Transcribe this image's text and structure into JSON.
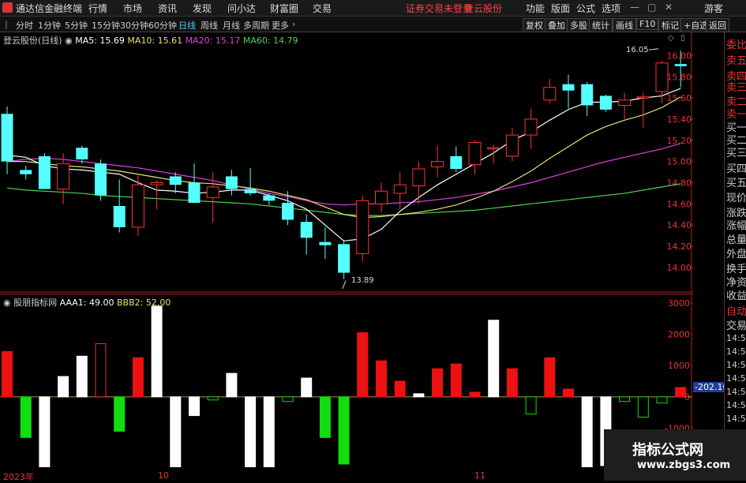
{
  "menubar": {
    "app_title": "通达信金融终端",
    "items": [
      "行情",
      "市场",
      "资讯",
      "发现",
      "问小达",
      "财富圈",
      "交易"
    ],
    "notice": "证券交易未登录",
    "stock": "登云股份",
    "right_items": [
      "功能",
      "版面",
      "公式",
      "选项"
    ],
    "user": "游客"
  },
  "toolbar": {
    "periods": [
      "分时",
      "1分钟",
      "5分钟",
      "15分钟",
      "30分钟",
      "60分钟",
      "日线",
      "周线",
      "月线",
      "多周期",
      "更多"
    ],
    "active_period": "日线",
    "right_buttons": [
      "复权",
      "叠加",
      "多股",
      "统计",
      "画线",
      "F10",
      "标记",
      "+自选",
      "返回"
    ]
  },
  "chart_header": {
    "stock_label": "登云股份(日线)",
    "ma5": "MA5: 15.69",
    "ma10": "MA10: 15.61",
    "ma20": "MA20: 15.17",
    "ma60": "MA60: 14.79"
  },
  "sub_header": {
    "name": "股朋指标网",
    "aaa1": "AAA1: 49.00",
    "bbb2": "BBB2: 52.00"
  },
  "annotations": {
    "high": "16.05",
    "low": "13.89",
    "current_sub": "-202.10"
  },
  "x_labels": [
    "2023年",
    "10",
    "11"
  ],
  "right_panel": {
    "red_items": [
      "委比",
      "卖五",
      "卖四",
      "卖三",
      "卖二",
      "卖一"
    ],
    "white_items": [
      "买一",
      "买二",
      "买三",
      "买四",
      "买五",
      "现价",
      "涨跌",
      "涨幅",
      "总量",
      "外盘",
      "换手",
      "净资",
      "收益"
    ],
    "bottom_items": [
      "自动",
      "交易"
    ],
    "times": [
      "14:55",
      "14:56",
      "14:56",
      "14:56",
      "14:56",
      "14:56",
      "14:56"
    ]
  },
  "watermark": {
    "title": "指标公式网",
    "url": "www.zbgs3.com"
  },
  "colors": {
    "up": "#ff3333",
    "down": "#54ffff",
    "ma5": "#ffffff",
    "ma10": "#e8e070",
    "ma20": "#e040e0",
    "ma60": "#50d050"
  },
  "chart_data": [
    {
      "type": "candlestick",
      "y_ticks": [
        16.0,
        15.8,
        15.6,
        15.4,
        15.2,
        15.0,
        14.8,
        14.6,
        14.4,
        14.2,
        14.0
      ],
      "ylim": [
        13.85,
        16.1
      ],
      "candles": [
        {
          "o": 15.45,
          "h": 15.52,
          "l": 14.88,
          "c": 15.0
        },
        {
          "o": 14.92,
          "h": 14.96,
          "l": 14.83,
          "c": 14.88
        },
        {
          "o": 15.05,
          "h": 15.08,
          "l": 14.78,
          "c": 14.74
        },
        {
          "o": 14.74,
          "h": 15.08,
          "l": 14.6,
          "c": 14.98
        },
        {
          "o": 15.13,
          "h": 15.15,
          "l": 14.98,
          "c": 15.02
        },
        {
          "o": 14.98,
          "h": 15.02,
          "l": 14.63,
          "c": 14.68
        },
        {
          "o": 14.58,
          "h": 14.83,
          "l": 14.33,
          "c": 14.38
        },
        {
          "o": 14.38,
          "h": 14.87,
          "l": 14.3,
          "c": 14.78
        },
        {
          "o": 14.78,
          "h": 14.82,
          "l": 14.55,
          "c": 14.8
        },
        {
          "o": 14.86,
          "h": 14.9,
          "l": 14.7,
          "c": 14.78
        },
        {
          "o": 14.8,
          "h": 14.98,
          "l": 14.62,
          "c": 14.61
        },
        {
          "o": 14.66,
          "h": 14.9,
          "l": 14.42,
          "c": 14.76
        },
        {
          "o": 14.86,
          "h": 14.92,
          "l": 14.68,
          "c": 14.74
        },
        {
          "o": 14.74,
          "h": 14.94,
          "l": 14.68,
          "c": 14.7
        },
        {
          "o": 14.68,
          "h": 14.7,
          "l": 14.59,
          "c": 14.63
        },
        {
          "o": 14.61,
          "h": 14.72,
          "l": 14.4,
          "c": 14.45
        },
        {
          "o": 14.43,
          "h": 14.5,
          "l": 14.12,
          "c": 14.28
        },
        {
          "o": 14.24,
          "h": 14.38,
          "l": 14.08,
          "c": 14.21
        },
        {
          "o": 14.22,
          "h": 14.26,
          "l": 13.89,
          "c": 13.95
        },
        {
          "o": 14.13,
          "h": 14.68,
          "l": 14.06,
          "c": 14.63
        },
        {
          "o": 14.6,
          "h": 14.8,
          "l": 14.52,
          "c": 14.72
        },
        {
          "o": 14.7,
          "h": 14.9,
          "l": 14.55,
          "c": 14.78
        },
        {
          "o": 14.77,
          "h": 15.0,
          "l": 14.6,
          "c": 14.93
        },
        {
          "o": 14.95,
          "h": 15.15,
          "l": 14.85,
          "c": 15.0
        },
        {
          "o": 15.05,
          "h": 15.14,
          "l": 14.9,
          "c": 14.93
        },
        {
          "o": 14.97,
          "h": 15.2,
          "l": 14.88,
          "c": 15.18
        },
        {
          "o": 15.13,
          "h": 15.16,
          "l": 14.98,
          "c": 15.13
        },
        {
          "o": 15.05,
          "h": 15.32,
          "l": 15.0,
          "c": 15.25
        },
        {
          "o": 15.25,
          "h": 15.5,
          "l": 15.12,
          "c": 15.4
        },
        {
          "o": 15.58,
          "h": 15.78,
          "l": 15.55,
          "c": 15.7
        },
        {
          "o": 15.73,
          "h": 15.82,
          "l": 15.5,
          "c": 15.67
        },
        {
          "o": 15.73,
          "h": 15.75,
          "l": 15.43,
          "c": 15.53
        },
        {
          "o": 15.62,
          "h": 15.63,
          "l": 15.47,
          "c": 15.49
        },
        {
          "o": 15.53,
          "h": 15.65,
          "l": 15.4,
          "c": 15.58
        },
        {
          "o": 15.6,
          "h": 15.65,
          "l": 15.32,
          "c": 15.61
        },
        {
          "o": 15.66,
          "h": 15.95,
          "l": 15.55,
          "c": 15.93
        },
        {
          "o": 15.92,
          "h": 16.05,
          "l": 15.7,
          "c": 15.9
        }
      ],
      "ma5": [
        15.06,
        15.04,
        14.96,
        14.93,
        14.92,
        14.9,
        14.88,
        14.8,
        14.73,
        14.72,
        14.7,
        14.71,
        14.73,
        14.73,
        14.68,
        14.63,
        14.55,
        14.4,
        14.25,
        14.27,
        14.36,
        14.53,
        14.66,
        14.78,
        14.88,
        14.98,
        15.08,
        15.2,
        15.28,
        15.39,
        15.49,
        15.56,
        15.56,
        15.57,
        15.6,
        15.62,
        15.69
      ],
      "ma10": [
        15.0,
        15.0,
        14.98,
        14.96,
        14.95,
        14.93,
        14.91,
        14.88,
        14.85,
        14.82,
        14.8,
        14.79,
        14.77,
        14.75,
        14.72,
        14.68,
        14.64,
        14.57,
        14.5,
        14.47,
        14.48,
        14.5,
        14.52,
        14.55,
        14.59,
        14.65,
        14.72,
        14.81,
        14.91,
        15.03,
        15.14,
        15.25,
        15.33,
        15.39,
        15.44,
        15.51,
        15.61
      ],
      "ma20": [
        15.0,
        15.02,
        15.03,
        15.02,
        15.0,
        14.98,
        14.96,
        14.94,
        14.91,
        14.88,
        14.85,
        14.82,
        14.78,
        14.74,
        14.7,
        14.67,
        14.63,
        14.6,
        14.59,
        14.6,
        14.6,
        14.61,
        14.62,
        14.64,
        14.66,
        14.69,
        14.72,
        14.76,
        14.8,
        14.85,
        14.9,
        14.95,
        15.0,
        15.04,
        15.08,
        15.12,
        15.17
      ],
      "ma60": [
        14.75,
        14.73,
        14.72,
        14.71,
        14.7,
        14.68,
        14.67,
        14.66,
        14.65,
        14.64,
        14.63,
        14.62,
        14.61,
        14.6,
        14.58,
        14.56,
        14.54,
        14.52,
        14.5,
        14.49,
        14.49,
        14.5,
        14.51,
        14.52,
        14.53,
        14.54,
        14.56,
        14.58,
        14.6,
        14.62,
        14.64,
        14.66,
        14.68,
        14.7,
        14.73,
        14.76,
        14.79
      ]
    },
    {
      "type": "bar",
      "title": "股朋指标网",
      "y_ticks": [
        3000,
        2000,
        1000,
        0,
        -1000
      ],
      "ylim": [
        -2200,
        3200
      ],
      "values": [
        1450,
        -1300,
        -2550,
        650,
        1300,
        1700,
        -1100,
        1250,
        2900,
        -2450,
        -600,
        -100,
        750,
        -2450,
        -2450,
        -150,
        600,
        -1300,
        -2150,
        2050,
        1150,
        500,
        100,
        900,
        1050,
        150,
        2450,
        900,
        -550,
        1250,
        250,
        -2900,
        -2200,
        -150,
        -650,
        -200,
        300
      ]
    }
  ]
}
